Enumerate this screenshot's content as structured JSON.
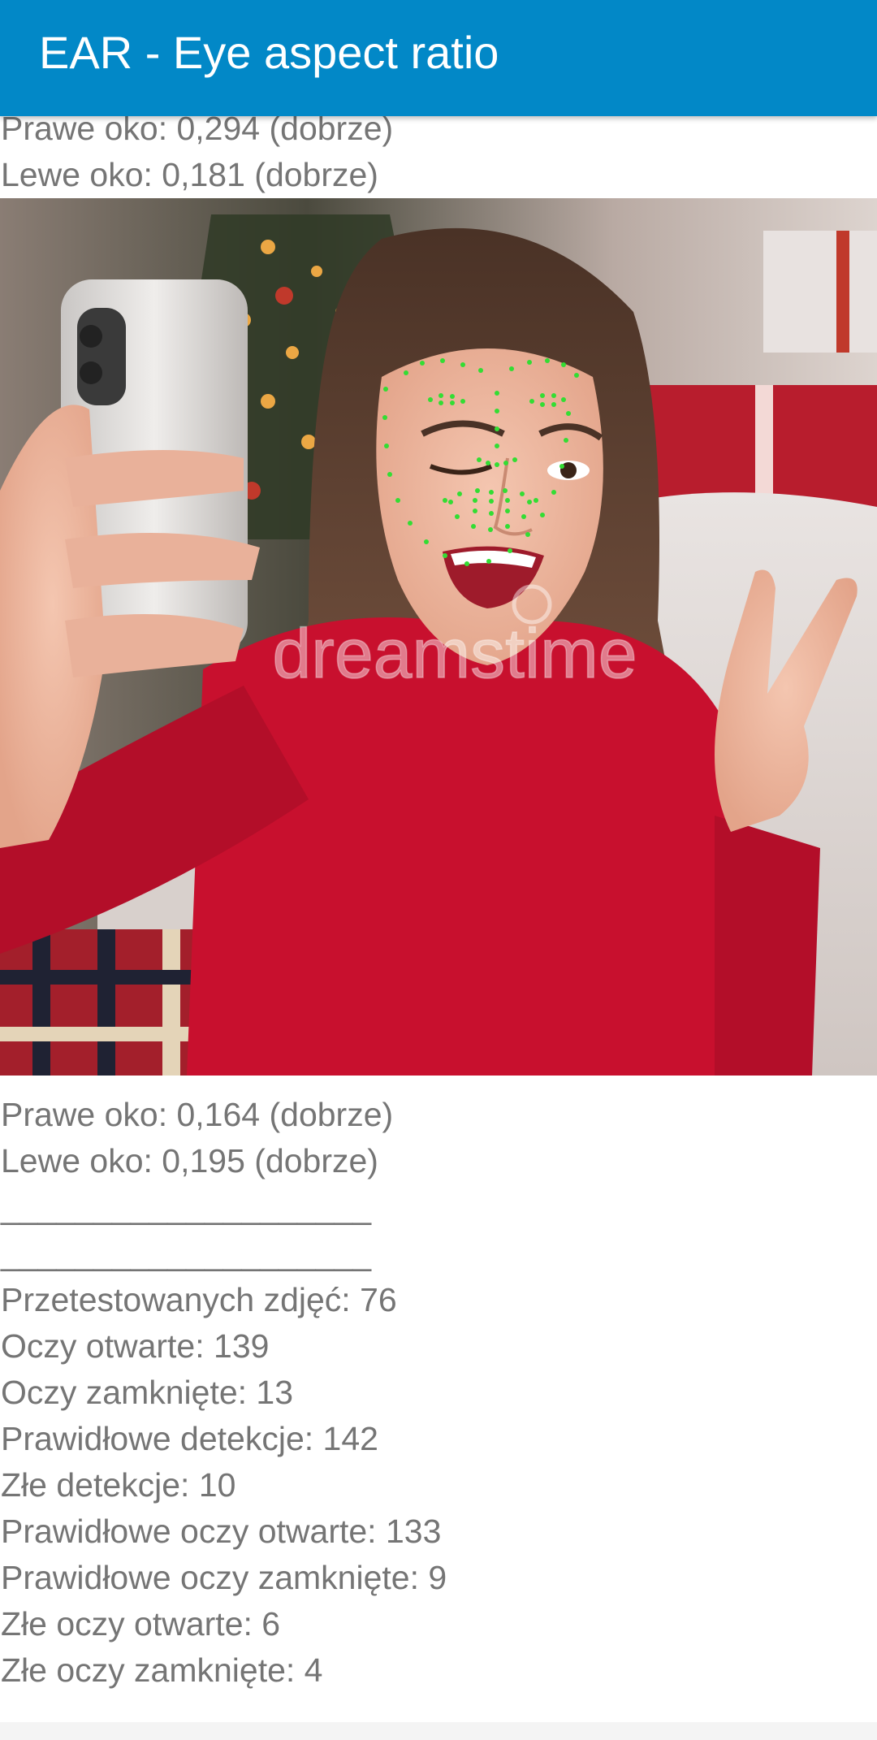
{
  "app_bar": {
    "title": "EAR - Eye aspect ratio"
  },
  "colors": {
    "app_bar": "#0288c7",
    "text": "#757575",
    "landmarks": "#33dd33",
    "sweater": "#c8102e"
  },
  "results": {
    "first_right_eye": "Prawe oko: 0,294 (dobrze)",
    "first_left_eye": "Lewe oko: 0,181 (dobrze)",
    "second_right_eye": "Prawe oko: 0,164 (dobrze)",
    "second_left_eye": "Lewe oko: 0,195 (dobrze)"
  },
  "separators": {
    "first": "____________________",
    "second": "____________________",
    "third": "____________________"
  },
  "image": {
    "watermark": "dreamstime"
  },
  "stats": [
    "Przetestowanych zdjęć: 76",
    "Oczy otwarte: 139",
    "Oczy zamknięte: 13",
    "Prawidłowe detekcje: 142",
    "Złe detekcje: 10",
    "Prawidłowe oczy otwarte: 133",
    "Prawidłowe oczy zamknięte: 9",
    "Złe oczy otwarte: 6",
    "Złe oczy zamknięte: 4"
  ]
}
